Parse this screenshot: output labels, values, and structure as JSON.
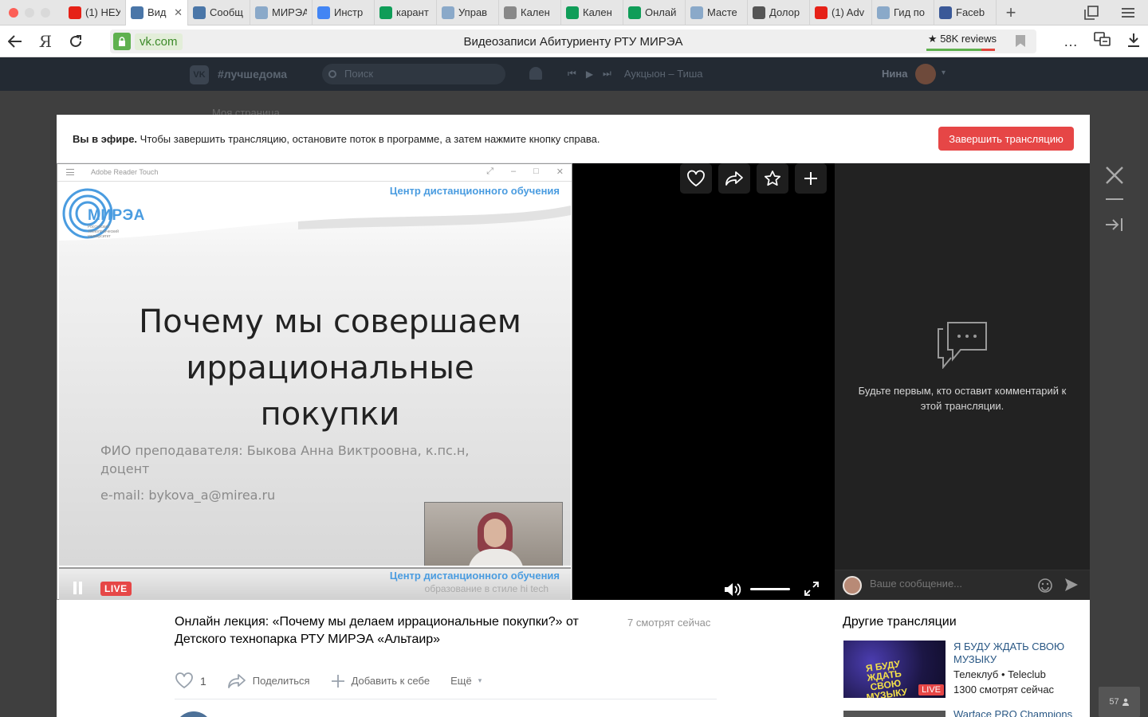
{
  "browser": {
    "tabs": [
      {
        "label": "(1) НЕУ",
        "icon": "youtube-icon",
        "color": "#e62117",
        "active": false
      },
      {
        "label": "Вид",
        "icon": "vk-icon",
        "color": "#4a76a8",
        "active": true
      },
      {
        "label": "Сообщ",
        "icon": "vk-message-icon",
        "color": "#4a76a8",
        "active": false
      },
      {
        "label": "МИРЭА",
        "icon": "mirea-icon",
        "color": "#8aa9c9",
        "active": false
      },
      {
        "label": "Инстр",
        "icon": "docs-icon",
        "color": "#4285f4",
        "active": false
      },
      {
        "label": "карант",
        "icon": "sheets-icon",
        "color": "#0f9d58",
        "active": false
      },
      {
        "label": "Управ",
        "icon": "mirea-icon",
        "color": "#8aa9c9",
        "active": false
      },
      {
        "label": "Кален",
        "icon": "document-icon",
        "color": "#888888",
        "active": false
      },
      {
        "label": "Кален",
        "icon": "sheets-icon",
        "color": "#0f9d58",
        "active": false
      },
      {
        "label": "Онлай",
        "icon": "sheets-icon",
        "color": "#0f9d58",
        "active": false
      },
      {
        "label": "Масте",
        "icon": "mirea-icon",
        "color": "#8aa9c9",
        "active": false
      },
      {
        "label": "Долор",
        "icon": "warning-icon",
        "color": "#555555",
        "active": false
      },
      {
        "label": "(1) Adv",
        "icon": "youtube-icon",
        "color": "#e62117",
        "active": false
      },
      {
        "label": "Гид по",
        "icon": "mirea-icon",
        "color": "#8aa9c9",
        "active": false
      },
      {
        "label": "Faceb",
        "icon": "facebook-icon",
        "color": "#3b5998",
        "active": false
      }
    ],
    "ya_label": "Я",
    "domain": "vk.com",
    "page_title": "Видеозаписи Абитуриенту РТУ МИРЭА",
    "reviews": "★ 58K reviews"
  },
  "vk": {
    "logo": "VK",
    "hashtag": "#лучшедома",
    "search_placeholder": "Поиск",
    "track": "Аукцыон – Тиша",
    "user_name": "Нина",
    "behind_link": "Моя страница"
  },
  "banner": {
    "strong": "Вы в эфире.",
    "text": " Чтобы завершить трансляцию, остановите поток в программе, а затем нажмите кнопку справа.",
    "end_button": "Завершить трансляцию"
  },
  "reader": {
    "app_title": "Adobe Reader Touch"
  },
  "slide": {
    "header_1": "Центр дистанционного обучения",
    "header_2": "образование в стиле hi tech",
    "logo": "МИРЭА",
    "logo_sub": "Российский технологический университет",
    "title_line_1": "Почему мы совершаем",
    "title_line_2": "иррациональные",
    "title_line_3": "покупки",
    "fio": "ФИО преподавателя: Быкова Анна Виктроовна, к.пс.н, доцент",
    "email": "e-mail: bykova_a@mirea.ru"
  },
  "player": {
    "live_label": "LIVE",
    "volume_level": 1.0
  },
  "comments": {
    "empty_text": "Будьте первым, кто оставит комментарий к этой трансляции.",
    "input_placeholder": "Ваше сообщение..."
  },
  "video_info": {
    "title": "Онлайн лекция: «Почему мы делаем иррациональные покупки?» от Детского технопарка РТУ МИРЭА «Альтаир»",
    "viewers": "7 смотрят сейчас",
    "like_count": "1",
    "share_label": "Поделиться",
    "add_label": "Добавить к себе",
    "more_label": "Ещё"
  },
  "other": {
    "heading": "Другие трансляции",
    "items": [
      {
        "title": "Я БУДУ ЖДАТЬ СВОЮ МУЗЫКУ",
        "author": "Телеклуб • Teleclub",
        "views": "1300 смотрят сейчас",
        "live": "LIVE",
        "thumb_text": "Я БУДУ ЖДАТЬ СВОЮ МУЗЫКУ"
      },
      {
        "title": "Warface PRO Champions"
      }
    ]
  },
  "counter": "57"
}
